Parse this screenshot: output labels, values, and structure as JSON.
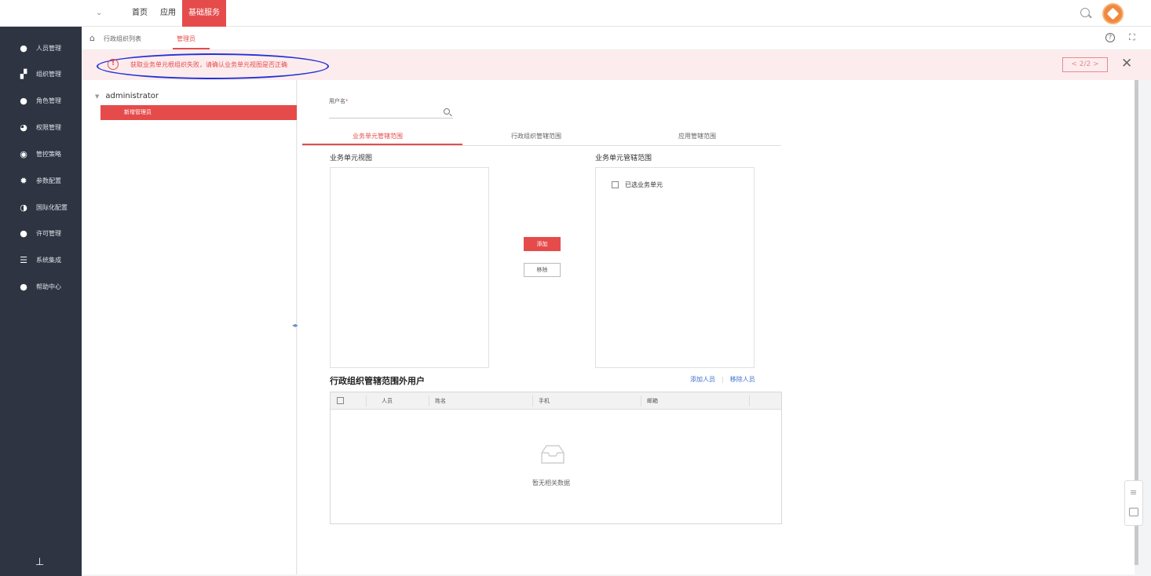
{
  "topbar": {
    "nav": [
      "首页",
      "应用",
      "基础服务"
    ],
    "active_nav": "基础服务"
  },
  "sidebar": {
    "items": [
      {
        "label": "人员管理",
        "icon": "person-icon"
      },
      {
        "label": "组织管理",
        "icon": "org-icon"
      },
      {
        "label": "角色管理",
        "icon": "role-icon"
      },
      {
        "label": "权限管理",
        "icon": "permission-icon"
      },
      {
        "label": "管控策略",
        "icon": "policy-icon"
      },
      {
        "label": "参数配置",
        "icon": "gear-icon"
      },
      {
        "label": "国际化配置",
        "icon": "globe-icon"
      },
      {
        "label": "许可管理",
        "icon": "license-icon"
      },
      {
        "label": "系统集成",
        "icon": "integration-icon"
      },
      {
        "label": "帮助中心",
        "icon": "help-icon"
      }
    ]
  },
  "breadcrumb": {
    "tab1": "行政组织列表",
    "tab2": "管理员"
  },
  "alert": {
    "message": "获取业务单元根组织失败，请确认业务单元视图是否正确",
    "pager": "< 2/2 >"
  },
  "tree": {
    "root": "administrator",
    "selected": "新增管理员"
  },
  "form": {
    "username_label": "用户名",
    "required_mark": "*"
  },
  "tabs": [
    "业务单元管辖范围",
    "行政组织管辖范围",
    "应用管辖范围"
  ],
  "transfer": {
    "left_title": "业务单元视图",
    "right_title": "业务单元管辖范围",
    "right_checkbox_label": "已选业务单元",
    "add_label": "添加",
    "remove_label": "移除"
  },
  "grid": {
    "title": "行政组织管辖范围外用户",
    "add_link": "添加人员",
    "remove_link": "移除人员",
    "columns": [
      "人员",
      "姓名",
      "手机",
      "邮箱"
    ],
    "empty_text": "暂无相关数据"
  }
}
